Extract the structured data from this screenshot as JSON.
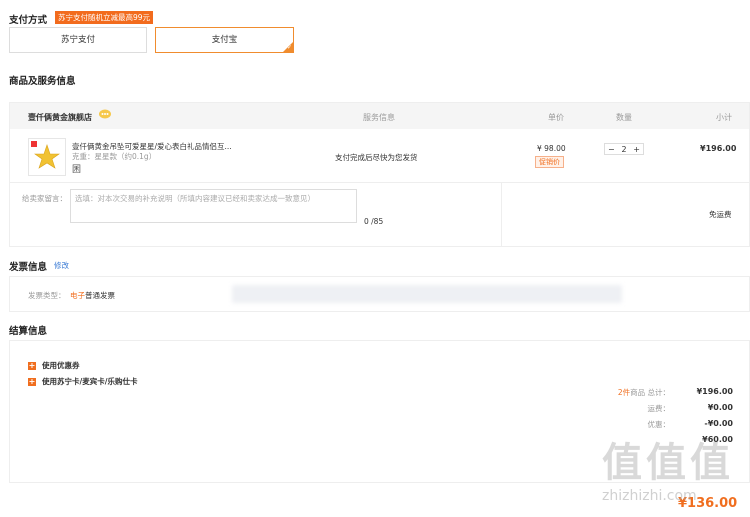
{
  "payment": {
    "title": "支付方式",
    "promo": "苏宁支付随机立减最高99元",
    "options": [
      "苏宁支付",
      "支付宝"
    ],
    "selected_index": 1
  },
  "goods": {
    "title": "商品及服务信息",
    "shop_name": "壹仟俩黄金旗舰店",
    "columns": {
      "service": "服务信息",
      "price": "单价",
      "qty": "数量",
      "subtotal": "小计"
    },
    "item": {
      "name": "壹仟俩黄金吊坠可爱星星/爱心表白礼品情侣互...",
      "attr_label": "克重：",
      "attr_value": "星星款（约0.1g）",
      "badge": "囷",
      "service": "支付完成后尽快为您发货",
      "price": "¥ 98.00",
      "price_tag": "促销价",
      "qty_minus": "−",
      "qty": "2",
      "qty_plus": "+",
      "subtotal": "¥196.00"
    },
    "message": {
      "label": "给卖家留言：",
      "placeholder": "选填：对本次交易的补充说明（所填内容建议已经和卖家达成一致意见）",
      "counter": "0 /85"
    },
    "shipping": "免运费"
  },
  "invoice": {
    "title": "发票信息",
    "edit": "修改",
    "type_label": "发票类型：",
    "type_electronic": "电子",
    "type_normal": "普通发票"
  },
  "settlement": {
    "title": "结算信息",
    "options": [
      "使用优惠券",
      "使用苏宁卡/麦宾卡/乐购仕卡"
    ],
    "summary": [
      {
        "label_count": "2件",
        "label": "商品 总计：",
        "value": "¥196.00"
      },
      {
        "label_count": "",
        "label": "运费：",
        "value": "¥0.00"
      },
      {
        "label_count": "",
        "label": "优惠：",
        "value": "-¥0.00"
      },
      {
        "label_count": "",
        "label": "",
        "value": "¥60.00"
      }
    ],
    "total": "¥136.00"
  },
  "watermark": "zhizhizhi.com",
  "colors": {
    "accent": "#f06e1f",
    "border": "#eeeeee",
    "header_bg": "#f5f5f5"
  }
}
